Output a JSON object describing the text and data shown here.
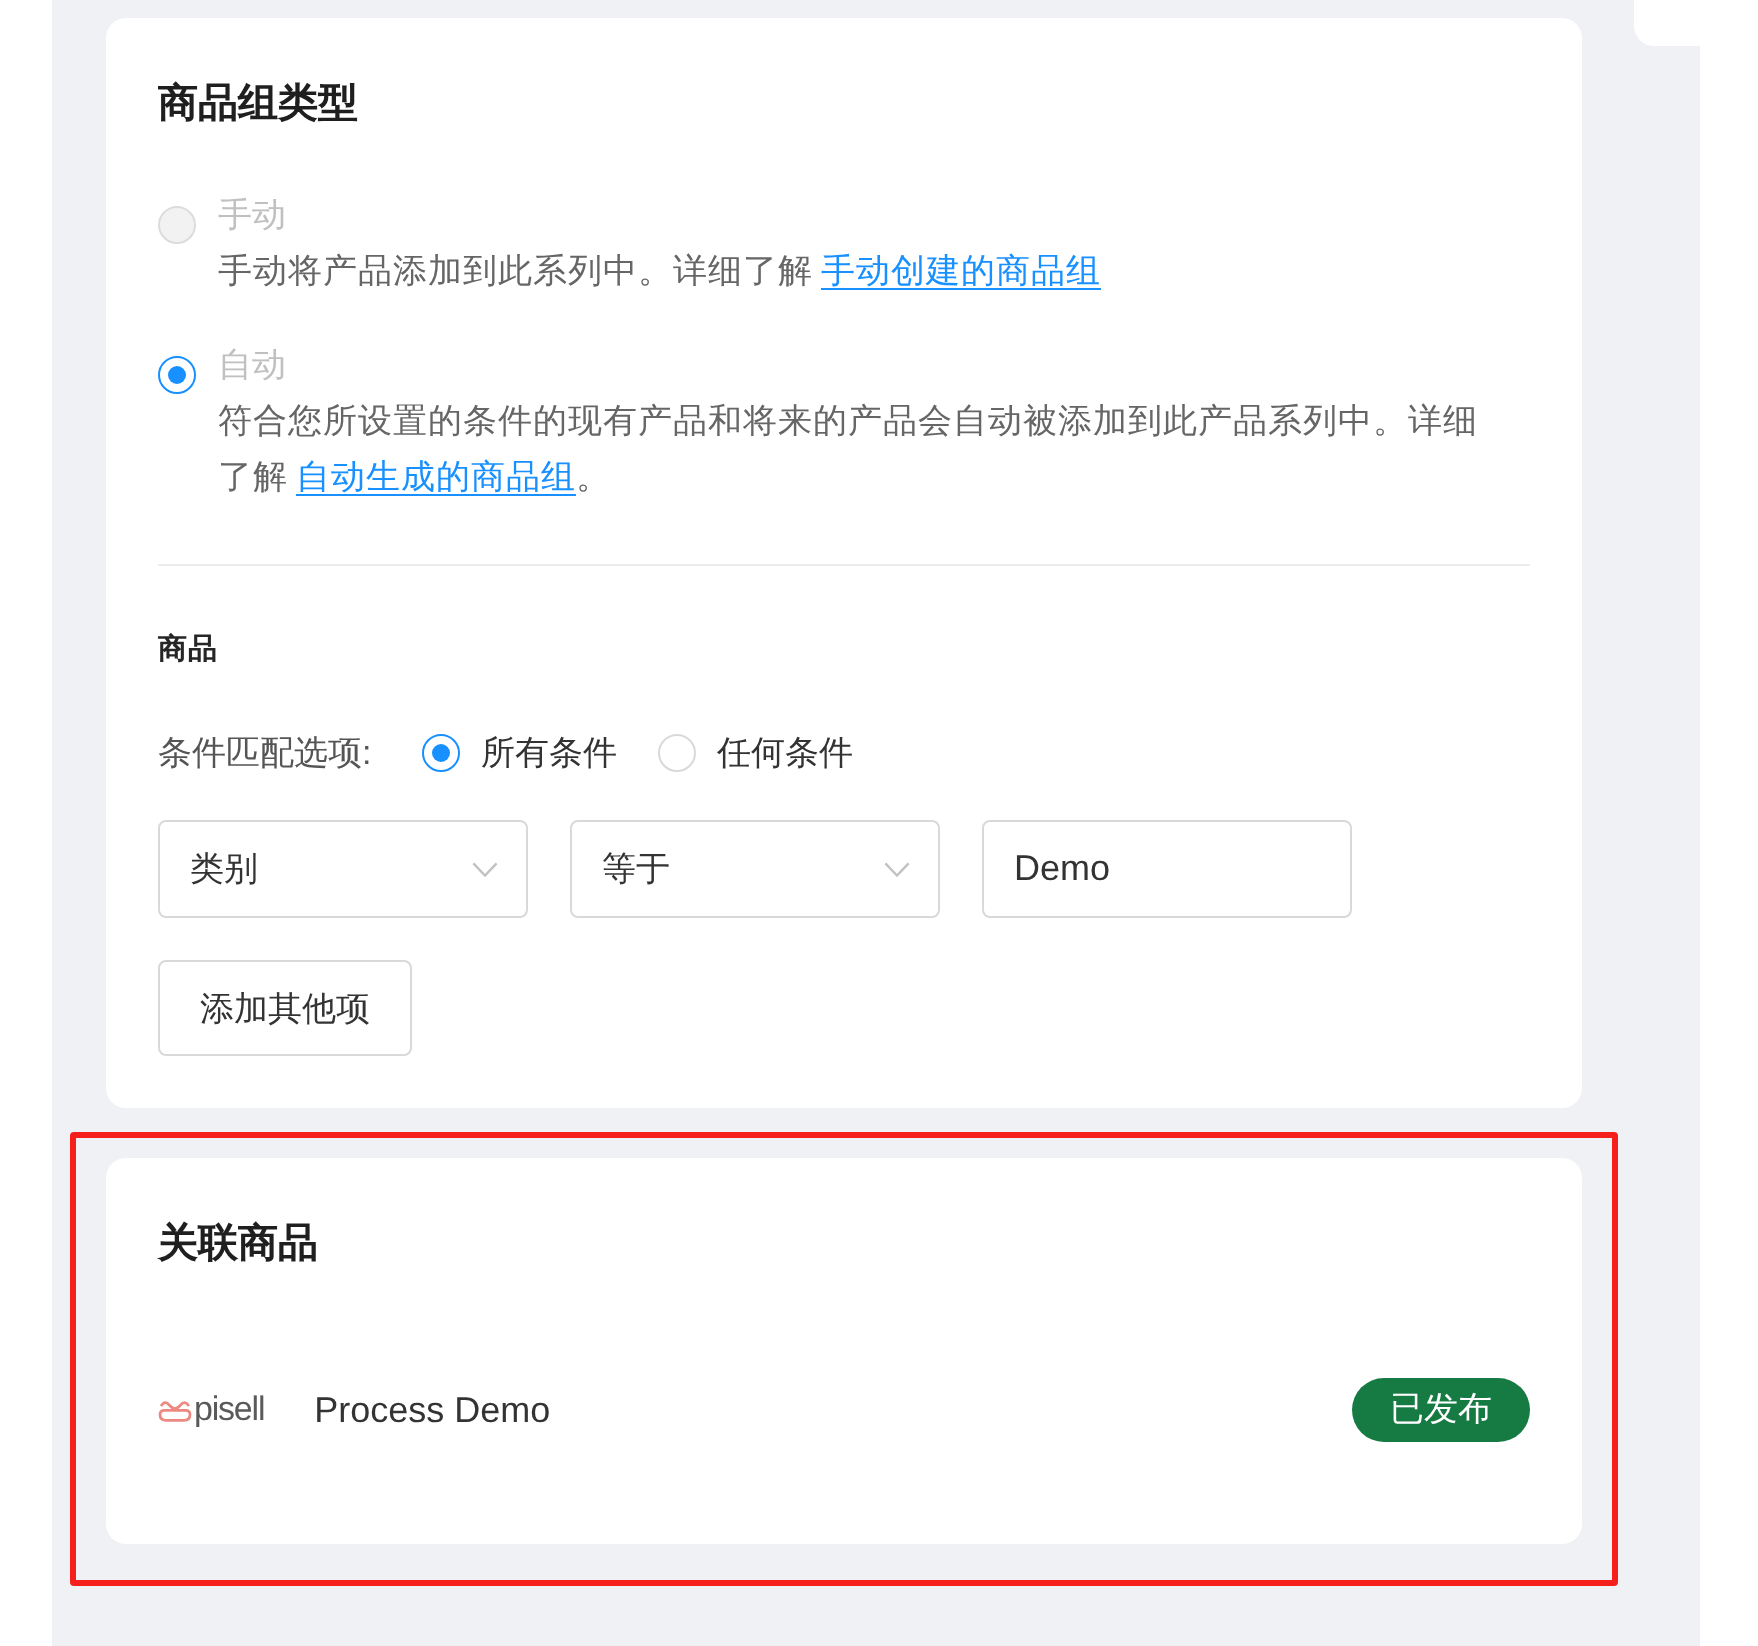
{
  "group_type": {
    "title": "商品组类型",
    "options": [
      {
        "label": "手动",
        "selected": false,
        "disabled": true,
        "description": "手动将产品添加到此系列中。详细了解",
        "link": "手动创建的商品组"
      },
      {
        "label": "自动",
        "selected": true,
        "disabled": true,
        "description": "符合您所设置的条件的现有产品和将来的产品会自动被添加到此产品系列中。详细了解",
        "link": "自动生成的商品组",
        "suffix": "。"
      }
    ]
  },
  "products": {
    "title": "商品",
    "match_label": "条件匹配选项:",
    "match_options": [
      {
        "label": "所有条件",
        "selected": true
      },
      {
        "label": "任何条件",
        "selected": false
      }
    ],
    "conditions": [
      {
        "kind": "select",
        "value": "类别"
      },
      {
        "kind": "select",
        "value": "等于"
      },
      {
        "kind": "input",
        "value": "Demo"
      }
    ],
    "add_button": "添加其他项"
  },
  "related_products": {
    "title": "关联商品",
    "highlighted": true,
    "items": [
      {
        "logo_text": "pisell",
        "name": "Process Demo",
        "status": "已发布"
      }
    ]
  }
}
